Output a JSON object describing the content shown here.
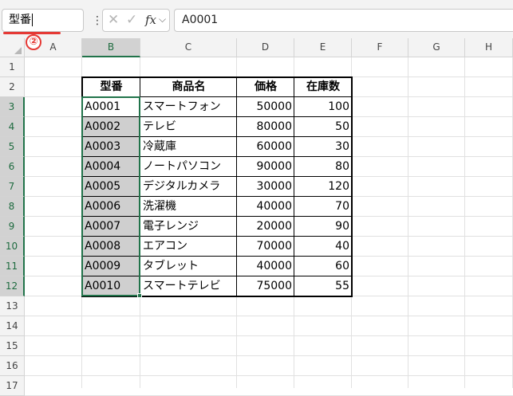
{
  "formula_bar": {
    "name_box_value": "型番",
    "step_badge": "②",
    "formula_value": "A0001",
    "icons": [
      "more-options-icon",
      "cancel-icon",
      "enter-icon",
      "function-icon",
      "chevron-down-icon"
    ],
    "accent_color": "#21734a",
    "annotation_color": "#e53935"
  },
  "column_headers": [
    "A",
    "B",
    "C",
    "D",
    "E",
    "F",
    "G",
    "H"
  ],
  "row_headers": [
    "1",
    "2",
    "3",
    "4",
    "5",
    "6",
    "7",
    "8",
    "9",
    "10",
    "11",
    "12",
    "13",
    "14",
    "15",
    "16",
    "17"
  ],
  "table": {
    "headers": [
      "型番",
      "商品名",
      "価格",
      "在庫数"
    ],
    "rows": [
      [
        "A0001",
        "スマートフォン",
        "50000",
        "100"
      ],
      [
        "A0002",
        "テレビ",
        "80000",
        "50"
      ],
      [
        "A0003",
        "冷蔵庫",
        "60000",
        "30"
      ],
      [
        "A0004",
        "ノートパソコン",
        "90000",
        "80"
      ],
      [
        "A0005",
        "デジタルカメラ",
        "30000",
        "120"
      ],
      [
        "A0006",
        "洗濯機",
        "40000",
        "70"
      ],
      [
        "A0007",
        "電子レンジ",
        "20000",
        "90"
      ],
      [
        "A0008",
        "エアコン",
        "70000",
        "40"
      ],
      [
        "A0009",
        "タブレット",
        "40000",
        "60"
      ],
      [
        "A0010",
        "スマートテレビ",
        "75000",
        "55"
      ]
    ]
  }
}
